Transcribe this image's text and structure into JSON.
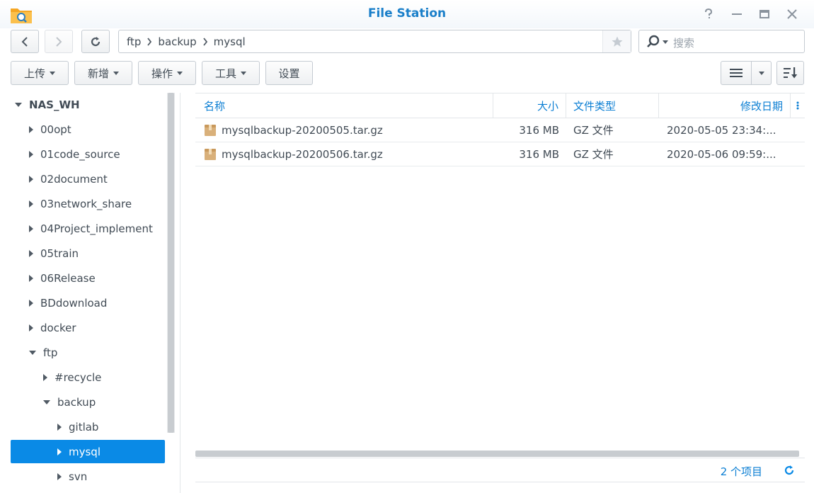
{
  "window": {
    "title": "File Station",
    "icons": {
      "app": "folder-search-icon",
      "help": "help-icon",
      "minimize": "minimize-icon",
      "maximize": "maximize-icon",
      "close": "close-icon"
    }
  },
  "nav": {
    "breadcrumbs": [
      "ftp",
      "backup",
      "mysql"
    ],
    "search_placeholder": "搜索"
  },
  "toolbar": {
    "upload": "上传",
    "create": "新增",
    "action": "操作",
    "tools": "工具",
    "settings": "设置"
  },
  "sidebar": {
    "root": "NAS_WH",
    "items": [
      {
        "label": "00opt",
        "expanded": false
      },
      {
        "label": "01code_source",
        "expanded": false
      },
      {
        "label": "02document",
        "expanded": false
      },
      {
        "label": "03network_share",
        "expanded": false
      },
      {
        "label": "04Project_implement",
        "expanded": false
      },
      {
        "label": "05train",
        "expanded": false
      },
      {
        "label": "06Release",
        "expanded": false
      },
      {
        "label": "BDdownload",
        "expanded": false
      },
      {
        "label": "docker",
        "expanded": false
      },
      {
        "label": "ftp",
        "expanded": true
      },
      {
        "label": "#recycle",
        "expanded": false
      },
      {
        "label": "backup",
        "expanded": true
      },
      {
        "label": "gitlab",
        "expanded": false
      },
      {
        "label": "mysql",
        "expanded": false,
        "selected": true
      },
      {
        "label": "svn",
        "expanded": false
      }
    ]
  },
  "file_list": {
    "columns": [
      "名称",
      "大小",
      "文件类型",
      "修改日期"
    ],
    "rows": [
      {
        "name": "mysqlbackup-20200505.tar.gz",
        "size": "316 MB",
        "type": "GZ 文件",
        "modified": "2020-05-05 23:34:..."
      },
      {
        "name": "mysqlbackup-20200506.tar.gz",
        "size": "316 MB",
        "type": "GZ 文件",
        "modified": "2020-05-06 09:59:..."
      }
    ],
    "item_count": "2 个项目"
  },
  "colors": {
    "accent": "#0a8ae6",
    "title": "#1a7fc9",
    "header_text": "#0a7ed3"
  }
}
